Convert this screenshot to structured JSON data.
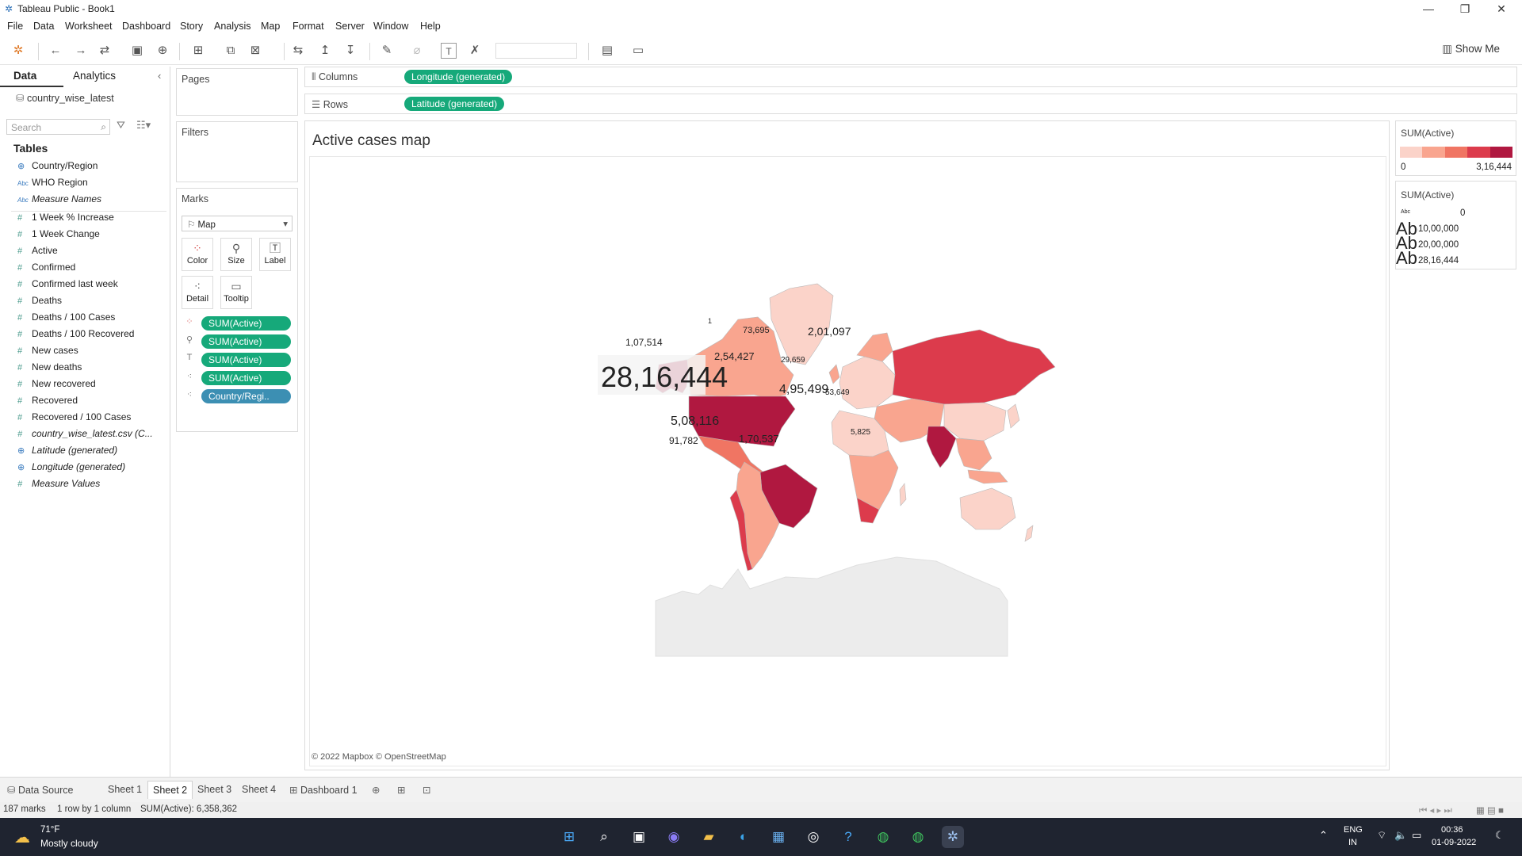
{
  "window": {
    "title": "Tableau Public - Book1"
  },
  "menu": [
    "File",
    "Data",
    "Worksheet",
    "Dashboard",
    "Story",
    "Analysis",
    "Map",
    "Format",
    "Server",
    "Window",
    "Help"
  ],
  "toolbar": {
    "show_me": "Show Me"
  },
  "data_pane": {
    "tabs": [
      "Data",
      "Analytics"
    ],
    "datasource": "country_wise_latest",
    "search_placeholder": "Search",
    "tables_header": "Tables",
    "dimensions": [
      {
        "icon": "globe-icon",
        "label": "Country/Region"
      },
      {
        "icon": "abc-icon",
        "label": "WHO Region"
      },
      {
        "icon": "abc-icon",
        "label": "Measure Names"
      }
    ],
    "measures": [
      {
        "icon": "hash-icon",
        "label": "1 Week % Increase"
      },
      {
        "icon": "hash-icon",
        "label": "1 Week Change"
      },
      {
        "icon": "hash-icon",
        "label": "Active"
      },
      {
        "icon": "hash-icon",
        "label": "Confirmed"
      },
      {
        "icon": "hash-icon",
        "label": "Confirmed last week"
      },
      {
        "icon": "hash-icon",
        "label": "Deaths"
      },
      {
        "icon": "hash-icon",
        "label": "Deaths / 100 Cases"
      },
      {
        "icon": "hash-icon",
        "label": "Deaths / 100 Recovered"
      },
      {
        "icon": "hash-icon",
        "label": "New cases"
      },
      {
        "icon": "hash-icon",
        "label": "New deaths"
      },
      {
        "icon": "hash-icon",
        "label": "New recovered"
      },
      {
        "icon": "hash-icon",
        "label": "Recovered"
      },
      {
        "icon": "hash-icon",
        "label": "Recovered / 100 Cases"
      },
      {
        "icon": "hash-icon",
        "label": "country_wise_latest.csv (C..."
      },
      {
        "icon": "globe-icon",
        "label": "Latitude (generated)"
      },
      {
        "icon": "globe-icon",
        "label": "Longitude (generated)"
      },
      {
        "icon": "hash-icon",
        "label": "Measure Values"
      }
    ]
  },
  "cards": {
    "pages": "Pages",
    "filters": "Filters",
    "marks": "Marks",
    "mark_type": "Map",
    "mark_buttons": [
      "Color",
      "Size",
      "Label",
      "Detail",
      "Tooltip"
    ],
    "mark_pills": [
      "SUM(Active)",
      "SUM(Active)",
      "SUM(Active)",
      "SUM(Active)",
      "Country/Regi.."
    ]
  },
  "shelves": {
    "columns_label": "Columns",
    "columns_pill": "Longitude (generated)",
    "rows_label": "Rows",
    "rows_pill": "Latitude (generated)"
  },
  "view": {
    "title": "Active cases map",
    "attribution": "© 2022 Mapbox © OpenStreetMap",
    "map_labels": [
      "28,16,444",
      "5,08,116",
      "4,95,499",
      "2,01,097",
      "1,70,537",
      "1,07,514",
      "91,782",
      "73,695",
      "2,54,427",
      "29,659",
      "53,649",
      "5,825",
      "1"
    ]
  },
  "legends": {
    "color": {
      "title": "SUM(Active)",
      "min": "0",
      "max": "3,16,444",
      "colors": [
        "#fbd3c9",
        "#f9a58f",
        "#f07563",
        "#dc3b4c",
        "#b01840"
      ]
    },
    "size": {
      "title": "SUM(Active)",
      "values": [
        "0",
        "10,00,000",
        "20,00,000",
        "28,16,444"
      ]
    }
  },
  "sheet_tabs": {
    "data_source": "Data Source",
    "tabs": [
      "Sheet 1",
      "Sheet 2",
      "Sheet 3",
      "Sheet 4",
      "Dashboard 1"
    ],
    "active": "Sheet 2"
  },
  "status": {
    "marks": "187 marks",
    "layout": "1 row by 1 column",
    "sum": "SUM(Active): 6,358,362"
  },
  "taskbar": {
    "weather_temp": "71°F",
    "weather_desc": "Mostly cloudy",
    "lang1": "ENG",
    "lang2": "IN",
    "time": "00:36",
    "date": "01-09-2022"
  }
}
